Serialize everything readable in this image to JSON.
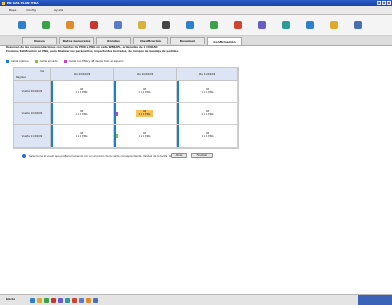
{
  "window": {
    "title": "EN GAS PLAN ITDA"
  },
  "menu": [
    {
      "label": "Base"
    },
    {
      "label": "Config"
    },
    {
      "label": "Ayuda"
    }
  ],
  "toolbar_icons": [
    {
      "name": "grid-icon",
      "color": "#2f7fcf"
    },
    {
      "name": "chart-icon",
      "color": "#3aa34a"
    },
    {
      "name": "person-icon",
      "color": "#e08a2b"
    },
    {
      "name": "flag-icon",
      "color": "#c9362f"
    },
    {
      "name": "printer-icon",
      "color": "#5b7cc8"
    },
    {
      "name": "doc-icon",
      "color": "#d9b23d"
    },
    {
      "name": "euro-icon",
      "color": "#444444"
    },
    {
      "name": "table-icon",
      "color": "#2f7fcf"
    },
    {
      "name": "calendar-icon",
      "color": "#3aa34a"
    },
    {
      "name": "refresh-icon",
      "color": "#d0452f"
    },
    {
      "name": "report-icon",
      "color": "#6b5bc8"
    },
    {
      "name": "tools-icon",
      "color": "#2a9c93"
    },
    {
      "name": "globe-icon",
      "color": "#2f7fcf"
    },
    {
      "name": "star-icon",
      "color": "#e0a92b"
    },
    {
      "name": "info-icon",
      "color": "#4a6fb0"
    }
  ],
  "tabs": [
    {
      "label": "Nuevo"
    },
    {
      "label": "Datos Generales"
    },
    {
      "label": "Rondas"
    },
    {
      "label": "Clasificación"
    },
    {
      "label": "Resumen"
    },
    {
      "label": "Confirmación"
    }
  ],
  "active_tab": 5,
  "description": [
    "Resumen de las recomendaciones con fuentes de PMD a ENG en cada WEBAPL, ordenadas de 1 CIUDAD",
    "Presione Ratificación en ENG, para finalizar los parámetros, importantes borrados, de campos de bandeja de pedidos."
  ],
  "legend": [
    {
      "label": "Celda pública",
      "color": "#1b7fd0"
    },
    {
      "label": "Celda privada",
      "color": "#7ec83a"
    },
    {
      "label": "Celda con ENG y 48 desde todo el espacio",
      "color": "#c242c2"
    }
  ],
  "grid": {
    "corner_top": "Ida",
    "corner_bottom": "Regreso",
    "columns": [
      "Ida 09/04/09",
      "Ida 10/04/09",
      "Ida 11/04/09"
    ],
    "rows": [
      "Vuelta 09/04/09",
      "Vuelta 10/04/09",
      "Vuelta 11/04/09"
    ],
    "cells": [
      [
        {
          "v1": "48",
          "v2": "1 x 1 ENG"
        },
        {
          "v1": "48",
          "v2": "1 x 1 ENG"
        },
        {
          "v1": "48",
          "v2": "1 x 1 ENG"
        }
      ],
      [
        {
          "v1": "48",
          "v2": "1 x 1 ENG"
        },
        {
          "v1": "48",
          "v2": "1 x 1 ENG"
        },
        {
          "v1": "48",
          "v2": "1 x 1 ENG"
        }
      ],
      [
        {
          "v1": "48",
          "v2": "1 x 1 ENG"
        },
        {
          "v1": "48",
          "v2": "1 x 1 ENG"
        },
        {
          "v1": "48",
          "v2": "1 x 1 ENG"
        }
      ]
    ]
  },
  "status": {
    "text": "Seleccione el vuelo que prefiera haciendo clic en el precio de la celda correspondiente. Validez de la tarifa: 48 h."
  },
  "buttons": {
    "back": "Atrás",
    "next": "Finalizar"
  },
  "taskbar": {
    "label": "Inicio"
  }
}
